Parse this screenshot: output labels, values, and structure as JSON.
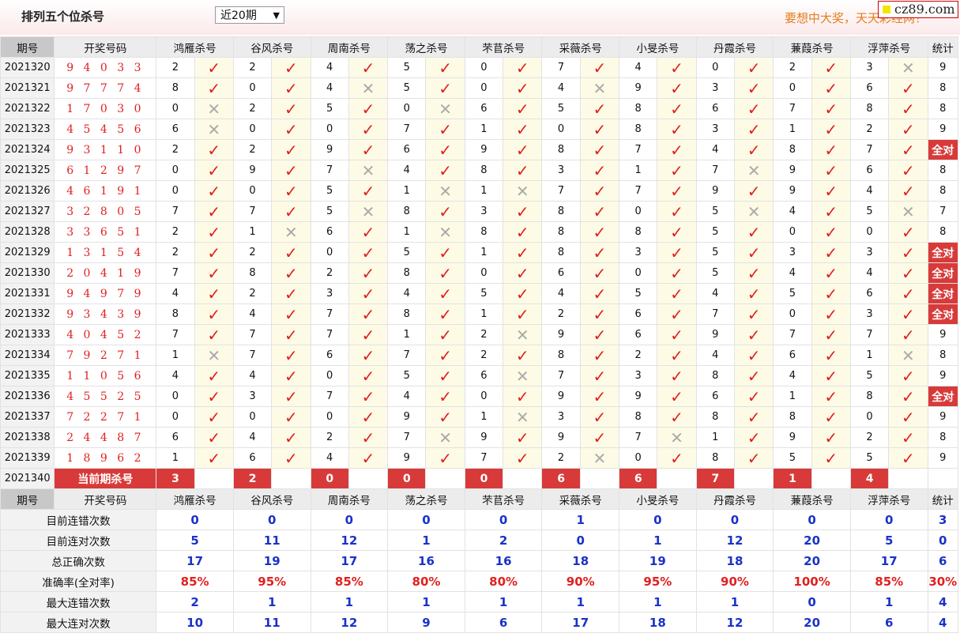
{
  "header": {
    "title": "排列五个位杀号",
    "select_value": "近20期",
    "slogan": "要想中大奖，天天彩经网！",
    "logo": "cz89.com"
  },
  "columns": {
    "issue": "期号",
    "draw": "开奖号码",
    "experts": [
      "鸿雁杀号",
      "谷风杀号",
      "周南杀号",
      "荡之杀号",
      "芣苢杀号",
      "采薇杀号",
      "小旻杀号",
      "丹霞杀号",
      "蒹葭杀号",
      "浮萍杀号"
    ],
    "stat": "统计"
  },
  "rows": [
    {
      "issue": "2021320",
      "draw": "9 4 0 3 3",
      "kills": [
        2,
        2,
        4,
        5,
        0,
        7,
        4,
        0,
        2,
        3
      ],
      "hits": [
        1,
        1,
        1,
        1,
        1,
        1,
        1,
        1,
        1,
        0
      ],
      "stat": "9"
    },
    {
      "issue": "2021321",
      "draw": "9 7 7 7 4",
      "kills": [
        8,
        0,
        4,
        5,
        0,
        4,
        9,
        3,
        0,
        6
      ],
      "hits": [
        1,
        1,
        0,
        1,
        1,
        0,
        1,
        1,
        1,
        1
      ],
      "stat": "8"
    },
    {
      "issue": "2021322",
      "draw": "1 7 0 3 0",
      "kills": [
        0,
        2,
        5,
        0,
        6,
        5,
        8,
        6,
        7,
        8
      ],
      "hits": [
        0,
        1,
        1,
        0,
        1,
        1,
        1,
        1,
        1,
        1
      ],
      "stat": "8"
    },
    {
      "issue": "2021323",
      "draw": "4 5 4 5 6",
      "kills": [
        6,
        0,
        0,
        7,
        1,
        0,
        8,
        3,
        1,
        2
      ],
      "hits": [
        0,
        1,
        1,
        1,
        1,
        1,
        1,
        1,
        1,
        1
      ],
      "stat": "9"
    },
    {
      "issue": "2021324",
      "draw": "9 3 1 1 0",
      "kills": [
        2,
        2,
        9,
        6,
        9,
        8,
        7,
        4,
        8,
        7
      ],
      "hits": [
        1,
        1,
        1,
        1,
        1,
        1,
        1,
        1,
        1,
        1
      ],
      "stat": "全对"
    },
    {
      "issue": "2021325",
      "draw": "6 1 2 9 7",
      "kills": [
        0,
        9,
        7,
        4,
        8,
        3,
        1,
        7,
        9,
        6
      ],
      "hits": [
        1,
        1,
        0,
        1,
        1,
        1,
        1,
        0,
        1,
        1
      ],
      "stat": "8"
    },
    {
      "issue": "2021326",
      "draw": "4 6 1 9 1",
      "kills": [
        0,
        0,
        5,
        1,
        1,
        7,
        7,
        9,
        9,
        4
      ],
      "hits": [
        1,
        1,
        1,
        0,
        0,
        1,
        1,
        1,
        1,
        1
      ],
      "stat": "8"
    },
    {
      "issue": "2021327",
      "draw": "3 2 8 0 5",
      "kills": [
        7,
        7,
        5,
        8,
        3,
        8,
        0,
        5,
        4,
        5
      ],
      "hits": [
        1,
        1,
        0,
        1,
        1,
        1,
        1,
        0,
        1,
        0
      ],
      "stat": "7"
    },
    {
      "issue": "2021328",
      "draw": "3 3 6 5 1",
      "kills": [
        2,
        1,
        6,
        1,
        8,
        8,
        8,
        5,
        0,
        0
      ],
      "hits": [
        1,
        0,
        1,
        0,
        1,
        1,
        1,
        1,
        1,
        1
      ],
      "stat": "8"
    },
    {
      "issue": "2021329",
      "draw": "1 3 1 5 4",
      "kills": [
        2,
        2,
        0,
        5,
        1,
        8,
        3,
        5,
        3,
        3
      ],
      "hits": [
        1,
        1,
        1,
        1,
        1,
        1,
        1,
        1,
        1,
        1
      ],
      "stat": "全对"
    },
    {
      "issue": "2021330",
      "draw": "2 0 4 1 9",
      "kills": [
        7,
        8,
        2,
        8,
        0,
        6,
        0,
        5,
        4,
        4
      ],
      "hits": [
        1,
        1,
        1,
        1,
        1,
        1,
        1,
        1,
        1,
        1
      ],
      "stat": "全对"
    },
    {
      "issue": "2021331",
      "draw": "9 4 9 7 9",
      "kills": [
        4,
        2,
        3,
        4,
        5,
        4,
        5,
        4,
        5,
        6
      ],
      "hits": [
        1,
        1,
        1,
        1,
        1,
        1,
        1,
        1,
        1,
        1
      ],
      "stat": "全对"
    },
    {
      "issue": "2021332",
      "draw": "9 3 4 3 9",
      "kills": [
        8,
        4,
        7,
        8,
        1,
        2,
        6,
        7,
        0,
        3
      ],
      "hits": [
        1,
        1,
        1,
        1,
        1,
        1,
        1,
        1,
        1,
        1
      ],
      "stat": "全对"
    },
    {
      "issue": "2021333",
      "draw": "4 0 4 5 2",
      "kills": [
        7,
        7,
        7,
        1,
        2,
        9,
        6,
        9,
        7,
        7
      ],
      "hits": [
        1,
        1,
        1,
        1,
        0,
        1,
        1,
        1,
        1,
        1
      ],
      "stat": "9"
    },
    {
      "issue": "2021334",
      "draw": "7 9 2 7 1",
      "kills": [
        1,
        7,
        6,
        7,
        2,
        8,
        2,
        4,
        6,
        1
      ],
      "hits": [
        0,
        1,
        1,
        1,
        1,
        1,
        1,
        1,
        1,
        0
      ],
      "stat": "8"
    },
    {
      "issue": "2021335",
      "draw": "1 1 0 5 6",
      "kills": [
        4,
        4,
        0,
        5,
        6,
        7,
        3,
        8,
        4,
        5
      ],
      "hits": [
        1,
        1,
        1,
        1,
        0,
        1,
        1,
        1,
        1,
        1
      ],
      "stat": "9"
    },
    {
      "issue": "2021336",
      "draw": "4 5 5 2 5",
      "kills": [
        0,
        3,
        7,
        4,
        0,
        9,
        9,
        6,
        1,
        8
      ],
      "hits": [
        1,
        1,
        1,
        1,
        1,
        1,
        1,
        1,
        1,
        1
      ],
      "stat": "全对"
    },
    {
      "issue": "2021337",
      "draw": "7 2 2 7 1",
      "kills": [
        0,
        0,
        0,
        9,
        1,
        3,
        8,
        8,
        8,
        0
      ],
      "hits": [
        1,
        1,
        1,
        1,
        0,
        1,
        1,
        1,
        1,
        1
      ],
      "stat": "9"
    },
    {
      "issue": "2021338",
      "draw": "2 4 4 8 7",
      "kills": [
        6,
        4,
        2,
        7,
        9,
        9,
        7,
        1,
        9,
        2
      ],
      "hits": [
        1,
        1,
        1,
        0,
        1,
        1,
        0,
        1,
        1,
        1
      ],
      "stat": "8"
    },
    {
      "issue": "2021339",
      "draw": "1 8 9 6 2",
      "kills": [
        1,
        6,
        4,
        9,
        7,
        2,
        0,
        8,
        5,
        5
      ],
      "hits": [
        1,
        1,
        1,
        1,
        1,
        0,
        1,
        1,
        1,
        1
      ],
      "stat": "9"
    }
  ],
  "current": {
    "issue": "2021340",
    "label": "当前期杀号",
    "kills": [
      3,
      2,
      0,
      0,
      0,
      6,
      6,
      7,
      1,
      4
    ]
  },
  "marks": {
    "right": "✓",
    "wrong": "✕"
  },
  "summary": [
    {
      "label": "目前连错次数",
      "values": [
        "0",
        "0",
        "0",
        "0",
        "0",
        "1",
        "0",
        "0",
        "0",
        "0"
      ],
      "stat": "3",
      "kind": "num"
    },
    {
      "label": "目前连对次数",
      "values": [
        "5",
        "11",
        "12",
        "1",
        "2",
        "0",
        "1",
        "12",
        "20",
        "5"
      ],
      "stat": "0",
      "kind": "num"
    },
    {
      "label": "总正确次数",
      "values": [
        "17",
        "19",
        "17",
        "16",
        "16",
        "18",
        "19",
        "18",
        "20",
        "17"
      ],
      "stat": "6",
      "kind": "num"
    },
    {
      "label": "准确率(全对率)",
      "values": [
        "85%",
        "95%",
        "85%",
        "80%",
        "80%",
        "90%",
        "95%",
        "90%",
        "100%",
        "85%"
      ],
      "stat": "30%",
      "kind": "rate"
    },
    {
      "label": "最大连错次数",
      "values": [
        "2",
        "1",
        "1",
        "1",
        "1",
        "1",
        "1",
        "1",
        "0",
        "1"
      ],
      "stat": "4",
      "kind": "num"
    },
    {
      "label": "最大连对次数",
      "values": [
        "10",
        "11",
        "12",
        "9",
        "6",
        "17",
        "18",
        "12",
        "20",
        "6"
      ],
      "stat": "4",
      "kind": "num"
    }
  ],
  "colors": {
    "accent": "#d83a3a",
    "hit": "#e02020",
    "miss": "#aaaaaa",
    "summary_num": "#1a32c8",
    "slogan": "#e47d1c"
  }
}
